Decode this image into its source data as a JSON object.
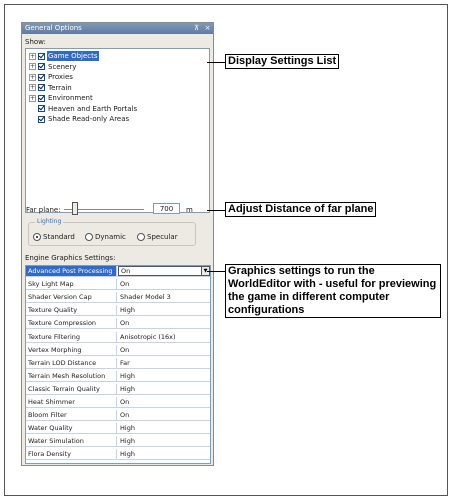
{
  "panel": {
    "title": "General Options",
    "pin_symbol": "⊼",
    "close_symbol": "×"
  },
  "display": {
    "label": "Show:",
    "items": [
      {
        "label": "Game Objects",
        "expandable": true,
        "selected": true
      },
      {
        "label": "Scenery",
        "expandable": true,
        "selected": false
      },
      {
        "label": "Proxies",
        "expandable": true,
        "selected": false
      },
      {
        "label": "Terrain",
        "expandable": true,
        "selected": false
      },
      {
        "label": "Environment",
        "expandable": true,
        "selected": false
      },
      {
        "label": "Heaven and Earth Portals",
        "expandable": false,
        "selected": false
      },
      {
        "label": "Shade Read-only Areas",
        "expandable": false,
        "selected": false
      }
    ]
  },
  "far_plane": {
    "label": "Far plane:",
    "value": "700",
    "unit": "m"
  },
  "lighting": {
    "title": "Lighting",
    "options": [
      "Standard",
      "Dynamic",
      "Specular"
    ],
    "selected": "Standard"
  },
  "engine": {
    "label": "Engine Graphics Settings:",
    "rows": [
      {
        "name": "Advanced Post Processing",
        "value": "On"
      },
      {
        "name": "Sky Light Map",
        "value": "On"
      },
      {
        "name": "Shader Version Cap",
        "value": "Shader Model 3"
      },
      {
        "name": "Texture Quality",
        "value": "High"
      },
      {
        "name": "Texture Compression",
        "value": "On"
      },
      {
        "name": "Texture Filtering",
        "value": "Anisotropic (16x)"
      },
      {
        "name": "Vertex Morphing",
        "value": "On"
      },
      {
        "name": "Terrain LOD Distance",
        "value": "Far"
      },
      {
        "name": "Terrain Mesh Resolution",
        "value": "High"
      },
      {
        "name": "Classic Terrain Quality",
        "value": "High"
      },
      {
        "name": "Heat Shimmer",
        "value": "On"
      },
      {
        "name": "Bloom Filter",
        "value": "On"
      },
      {
        "name": "Water Quality",
        "value": "High"
      },
      {
        "name": "Water Simulation",
        "value": "High"
      },
      {
        "name": "Flora Density",
        "value": "High"
      }
    ]
  },
  "callouts": {
    "display": "Display Settings List",
    "far_plane": "Adjust Distance of far plane",
    "graphics": "Graphics settings to run the WorldEditor with -  useful for previewing the game in different computer configurations"
  },
  "colors": {
    "selection": "#316ac5",
    "panel_bg": "#eceae3",
    "titlebar": "#6b86ab",
    "lighting_title": "#3a6fb0"
  }
}
